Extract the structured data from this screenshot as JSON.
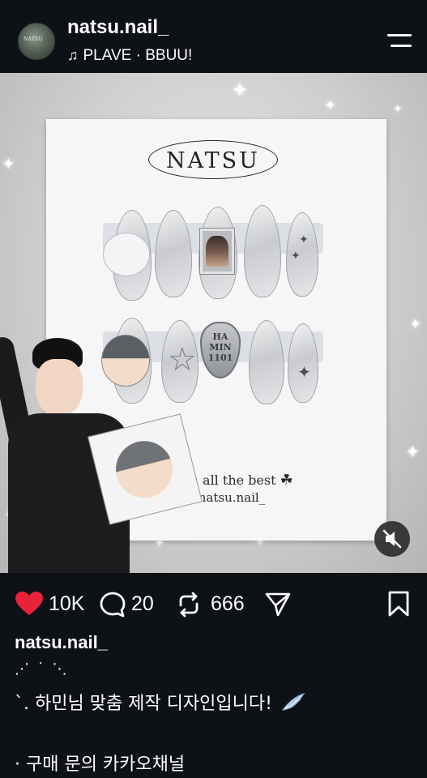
{
  "header": {
    "avatar_text": "NATSU",
    "username": "natsu.nail_",
    "music_icon": "music-note-icon",
    "music_text": "PLAVE · BBUU!"
  },
  "media": {
    "brand": "NATSU",
    "heart_lines": [
      "HA",
      "MIN",
      "1101"
    ],
    "card_text": "ou all the best",
    "card_handle": "@ natsu.nail_",
    "clover": "☘",
    "mute_icon": "muted-speaker-icon"
  },
  "actions": {
    "likes": "10K",
    "comments": "20",
    "reposts": "666",
    "like_color": "#e8223b"
  },
  "caption": {
    "username": "natsu.nail_",
    "line1": "⋰ ˙ ⋱",
    "line2": "`. 하민님 맞춤 제작 디자인입니다!",
    "line3": "· 구매 문의 카카오채널"
  }
}
